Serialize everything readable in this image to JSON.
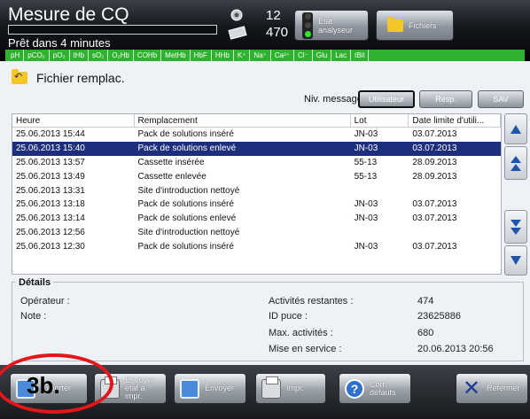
{
  "header": {
    "title": "Mesure de CQ",
    "status": "Prêt dans 4 minutes",
    "count_top": "12",
    "count_bottom": "470",
    "etat_button": "État analyseur",
    "fichiers_button": "Fichiers"
  },
  "params": [
    "pH",
    "pCO₂",
    "pO₂",
    "tHb",
    "sO₂",
    "O₂Hb",
    "COHb",
    "MetHb",
    "HbF",
    "HHb",
    "K⁺",
    "Na⁺",
    "Ca²⁺",
    "Cl⁻",
    "Glu",
    "Lac",
    "tBil"
  ],
  "page": {
    "heading": "Fichier remplac.",
    "niv_label": "Niv. message:",
    "niv_buttons": [
      "Utilisateur",
      "Resp.",
      "SAV"
    ]
  },
  "table": {
    "headers": [
      "Heure",
      "Remplacement",
      "Lot",
      "Date limite d'utili..."
    ],
    "rows": [
      {
        "heure": "25.06.2013 15:44",
        "remplacement": "Pack de solutions inséré",
        "lot": "JN-03",
        "date": "03.07.2013"
      },
      {
        "heure": "25.06.2013 15:40",
        "remplacement": "Pack de solutions enlevé",
        "lot": "JN-03",
        "date": "03.07.2013"
      },
      {
        "heure": "25.06.2013 13:57",
        "remplacement": "Cassette insérée",
        "lot": "55-13",
        "date": "28.09.2013"
      },
      {
        "heure": "25.06.2013 13:49",
        "remplacement": "Cassette enlevée",
        "lot": "55-13",
        "date": "28.09.2013"
      },
      {
        "heure": "25.06.2013 13:31",
        "remplacement": "Site d'introduction nettoyé",
        "lot": "",
        "date": ""
      },
      {
        "heure": "25.06.2013 13:18",
        "remplacement": "Pack de solutions inséré",
        "lot": "JN-03",
        "date": "03.07.2013"
      },
      {
        "heure": "25.06.2013 13:14",
        "remplacement": "Pack de solutions enlevé",
        "lot": "JN-03",
        "date": "03.07.2013"
      },
      {
        "heure": "25.06.2013 12:56",
        "remplacement": "Site d'introduction nettoyé",
        "lot": "",
        "date": ""
      },
      {
        "heure": "25.06.2013 12:30",
        "remplacement": "Pack de solutions inséré",
        "lot": "JN-03",
        "date": "03.07.2013"
      }
    ],
    "selected_index": 1
  },
  "details": {
    "title": "Détails",
    "operateur_label": "Opérateur :",
    "note_label": "Note :",
    "activites_label": "Activités restantes :",
    "activites_value": "474",
    "id_label": "ID puce :",
    "id_value": "23625886",
    "max_label": "Max. activités :",
    "max_value": "680",
    "mise_label": "Mise en service :",
    "mise_value": "20.06.2013 20:56"
  },
  "toolbar": {
    "exporter": "Exporter",
    "envoyer_etat": "Envoyer état à impr.",
    "envoyer": "Envoyer",
    "impr": "Impr.",
    "corr": "Corr. défauts",
    "refermer": "Refermer"
  },
  "annotation": {
    "label": "3b.",
    "color": "#e2171b"
  },
  "colors": {
    "selection": "#1d2f7c",
    "params_strip": "#2fb22f",
    "arrow": "#1e54a9"
  }
}
